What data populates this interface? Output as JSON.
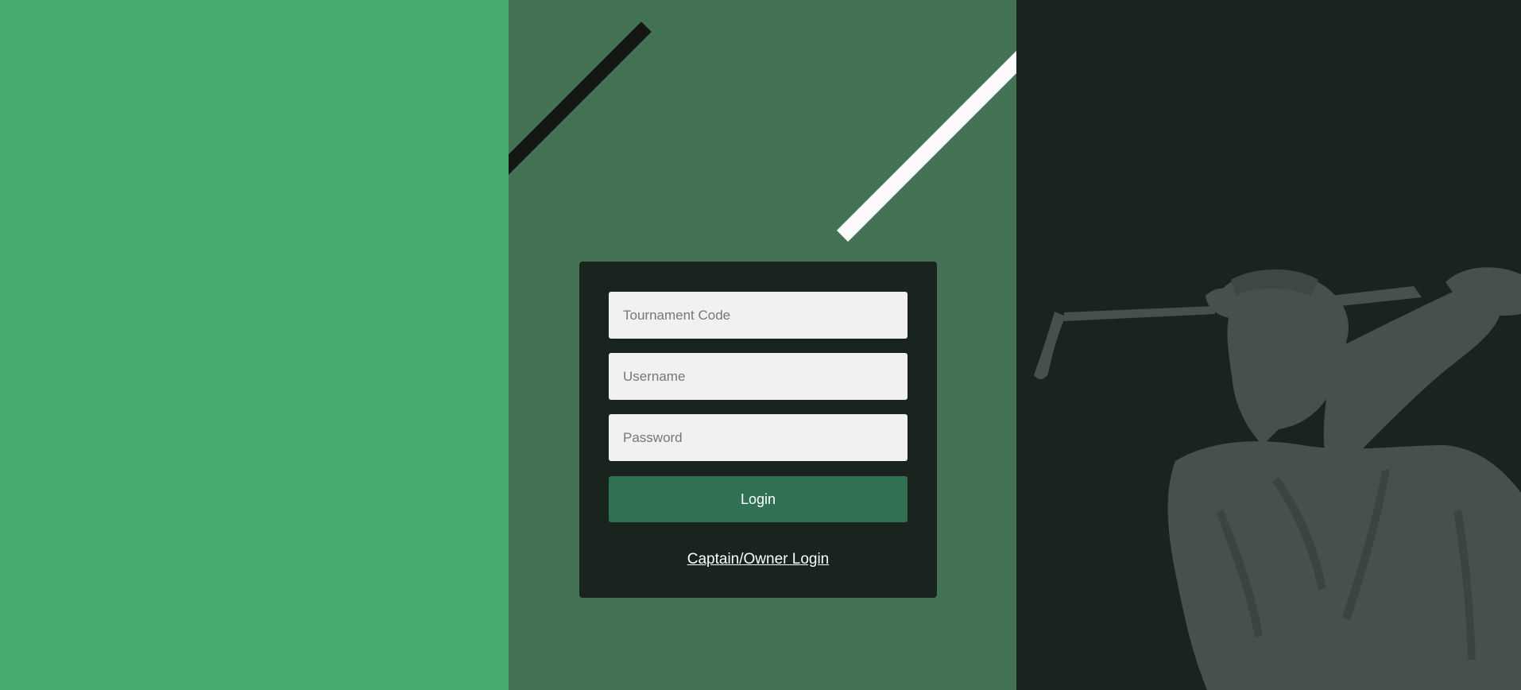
{
  "colors": {
    "left_panel": "#49ab6f",
    "middle_panel": "#437255",
    "right_panel": "#1b231f",
    "card": "#19241f",
    "button": "#2f7152",
    "golfer_silhouette": "#46514c"
  },
  "decor": {
    "golfer_icon": "golfer-silhouette-icon"
  },
  "login": {
    "tournament_code_placeholder": "Tournament Code",
    "username_placeholder": "Username",
    "password_placeholder": "Password",
    "login_button_label": "Login",
    "captain_owner_link": "Captain/Owner Login"
  }
}
